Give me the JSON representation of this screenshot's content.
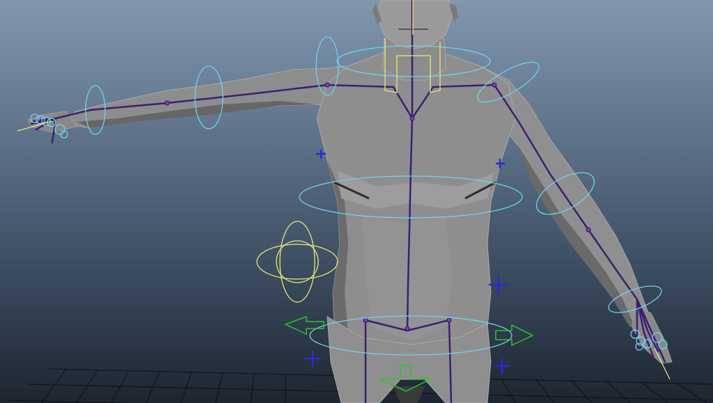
{
  "viewport": {
    "name": "maya-3d-viewport",
    "background_top": "#8296ad",
    "background_bottom": "#1d2530"
  },
  "colors": {
    "mesh_fill": "#8a8a8a",
    "mesh_light": "#a3a3a3",
    "mesh_dark": "#5a5a5a",
    "mesh_edge": "#b8b8b8",
    "joint": "#3b1f6e",
    "joint_highlight": "#7a3fc4",
    "control_cyan": "#6fd3f0",
    "control_yellow": "#e8e87a",
    "control_green": "#2cc52c",
    "control_blue": "#2a2ad8",
    "grid": "#101318"
  },
  "scene_objects": [
    "character-mesh",
    "skeleton-joints",
    "fk-control-curves",
    "ik-control-curves",
    "ground-grid"
  ]
}
